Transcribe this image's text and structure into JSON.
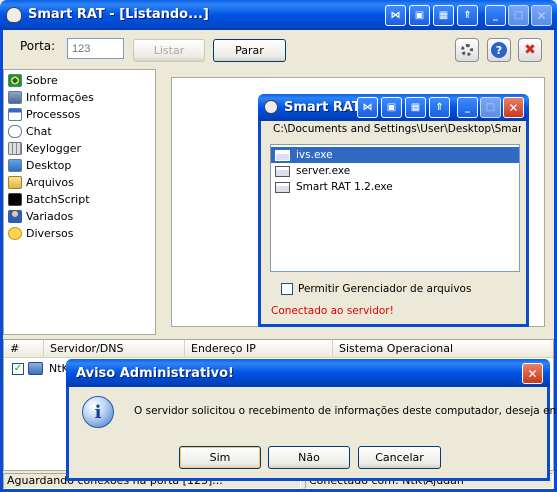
{
  "main_window": {
    "title": "Smart RAT - [Listando...]",
    "port_label": "Porta:",
    "port_placeholder": "123",
    "list_button": "Listar",
    "stop_button": "Parar"
  },
  "sidebar": {
    "items": [
      {
        "label": "Sobre",
        "icon": "brazil-flag-icon"
      },
      {
        "label": "Informações",
        "icon": "computer-info-icon"
      },
      {
        "label": "Processos",
        "icon": "processes-window-icon"
      },
      {
        "label": "Chat",
        "icon": "chat-bubble-icon"
      },
      {
        "label": "Keylogger",
        "icon": "keyboard-icon"
      },
      {
        "label": "Desktop",
        "icon": "desktop-monitor-icon"
      },
      {
        "label": "Arquivos",
        "icon": "folder-icon"
      },
      {
        "label": "BatchScript",
        "icon": "console-icon"
      },
      {
        "label": "Variados",
        "icon": "user-icon"
      },
      {
        "label": "Diversos",
        "icon": "smiley-icon"
      }
    ]
  },
  "table": {
    "columns": [
      "#",
      "Servidor/DNS",
      "Endereço IP",
      "Sistema Operacional"
    ],
    "rows": [
      {
        "server": "NtK"
      }
    ]
  },
  "status_bar": {
    "left": "Aguardando conexões na porta [123]...",
    "right": "Conectado com: NtK\\Ajudan"
  },
  "file_window": {
    "title": "Smart RAT A",
    "path": "C:\\Documents and Settings\\User\\Desktop\\Smart",
    "files": [
      "ivs.exe",
      "server.exe",
      "Smart RAT 1.2.exe"
    ],
    "checkbox_label": "Permitir Gerenciador de arquivos",
    "status": "Conectado ao servidor!"
  },
  "dialog": {
    "title": "Aviso Administrativo!",
    "message": "O servidor solicitou o recebimento de informações deste computador, deseja enviar?",
    "yes": "Sim",
    "no": "Não",
    "cancel": "Cancelar"
  },
  "colors": {
    "xp_blue": "#0054E3",
    "selection": "#316AC5",
    "error_red": "#E00000",
    "window_bg": "#ECE9D8"
  }
}
